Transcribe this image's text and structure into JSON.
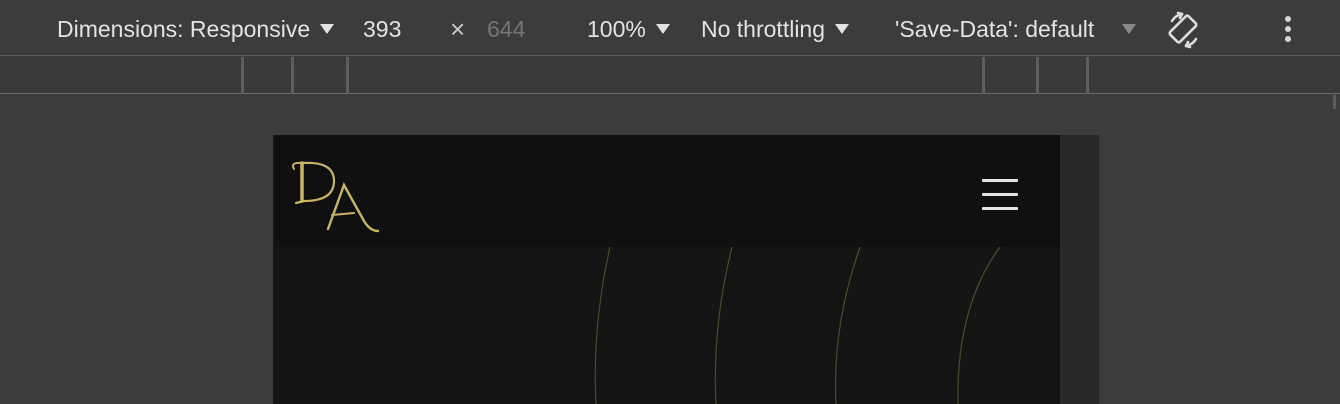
{
  "toolbar": {
    "dimensions_label": "Dimensions: Responsive",
    "width_value": "393",
    "times_symbol": "×",
    "height_value": "644",
    "zoom_label": "100%",
    "throttling_label": "No throttling",
    "save_data_label": "'Save-Data': default",
    "rotate_icon": "rotate-icon",
    "more_icon": "more-vertical-icon"
  },
  "site": {
    "logo_letters": "DA",
    "menu_icon": "hamburger-menu-icon",
    "accent_color": "#c8b464"
  }
}
